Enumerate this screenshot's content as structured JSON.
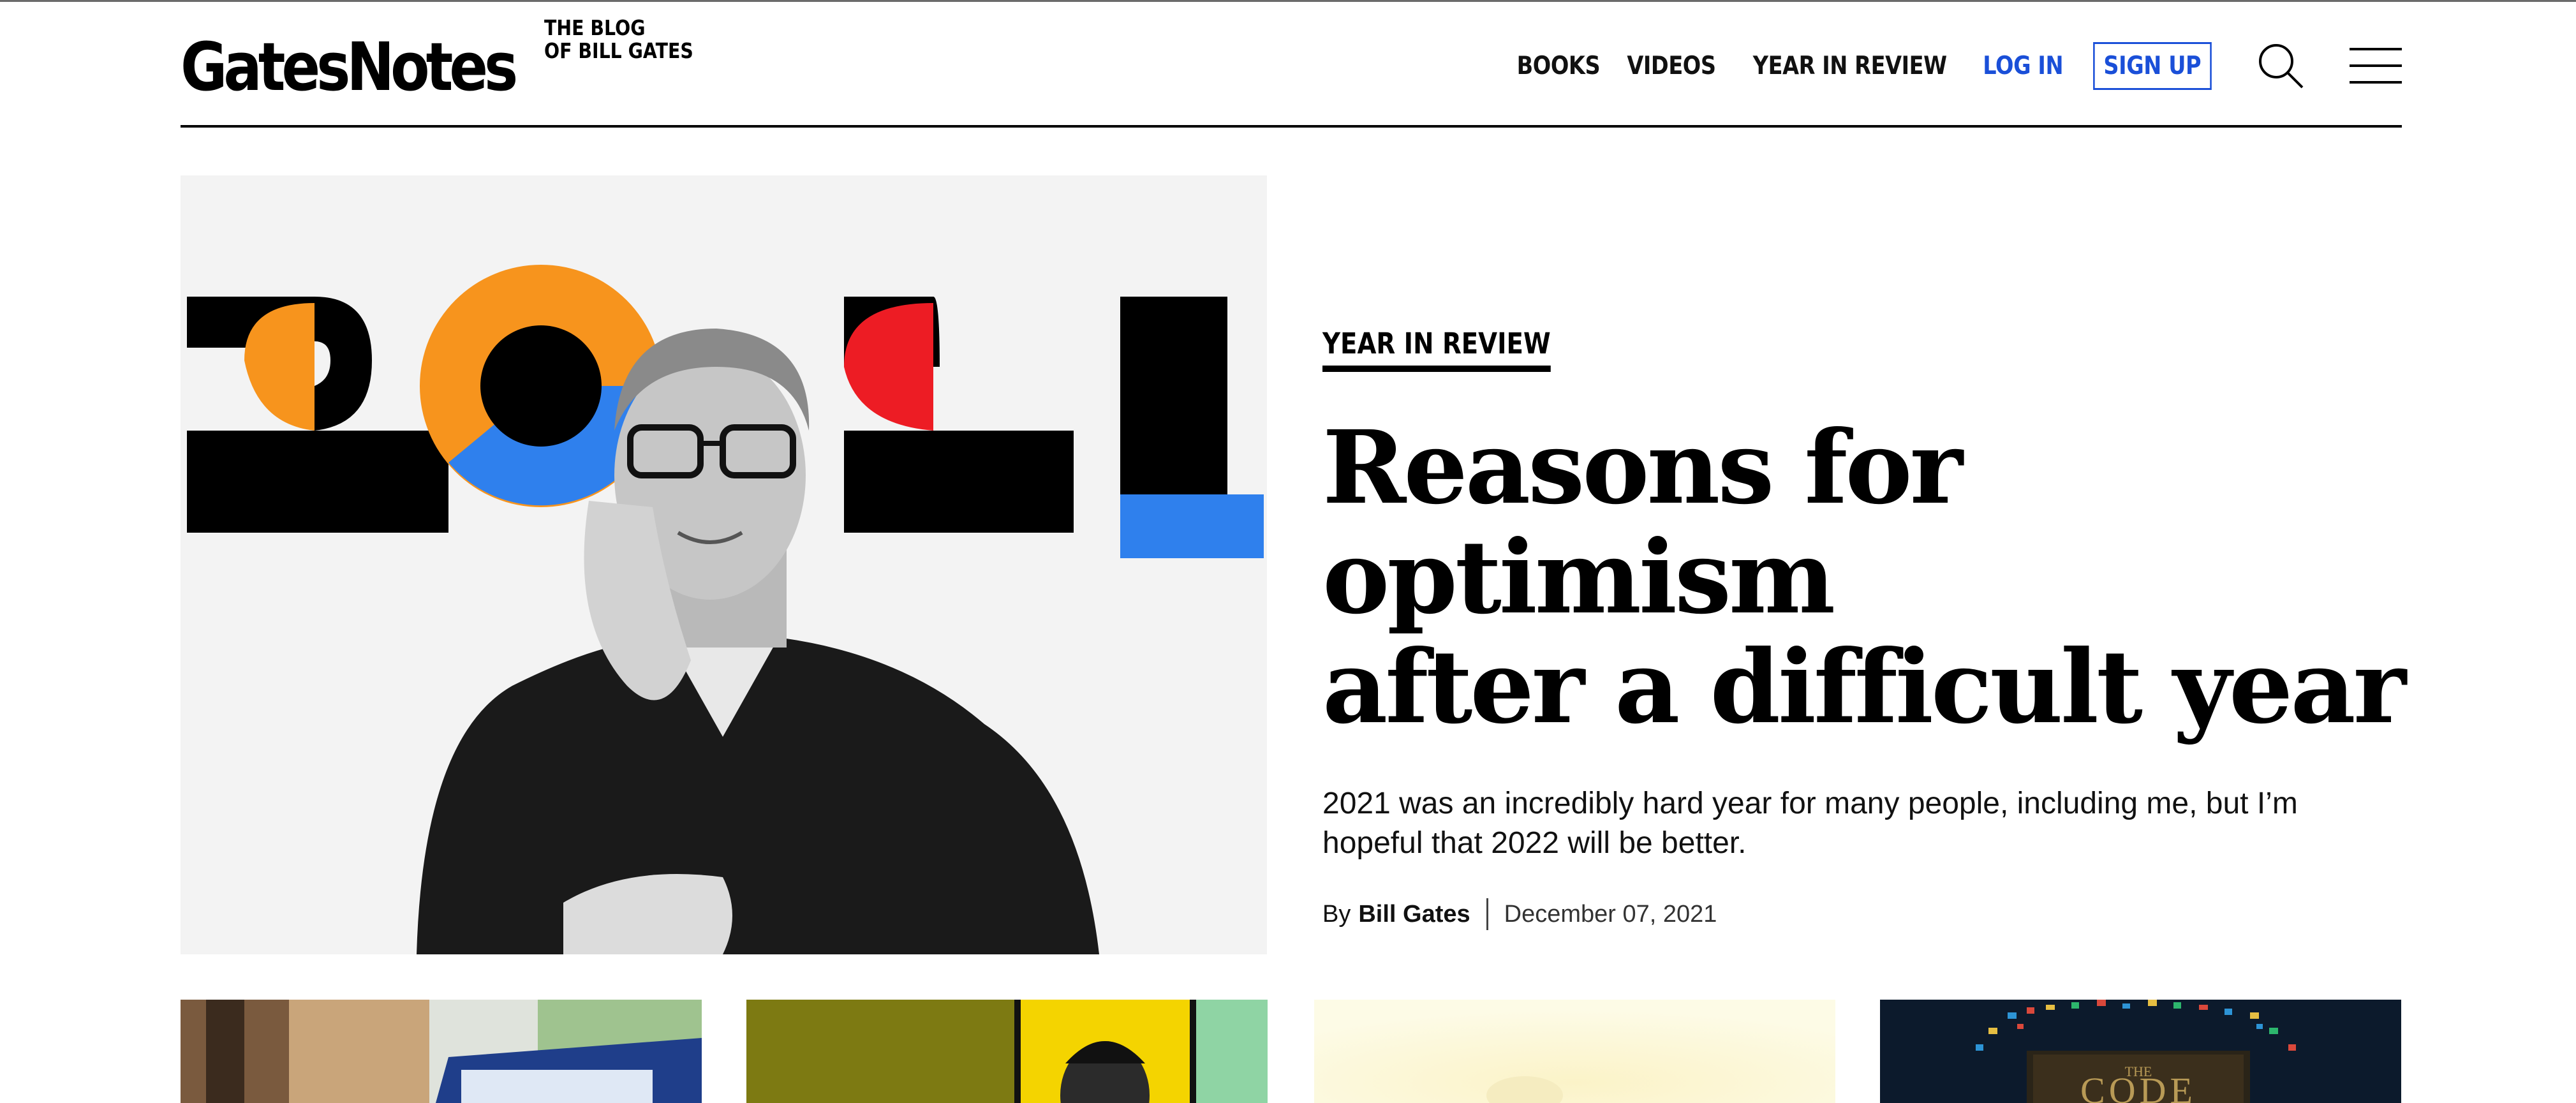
{
  "header": {
    "logo": "GatesNotes",
    "tagline_line1": "THE BLOG",
    "tagline_line2": "OF BILL GATES",
    "nav": [
      {
        "label": "BOOKS"
      },
      {
        "label": "VIDEOS"
      },
      {
        "label": "YEAR IN REVIEW"
      },
      {
        "label": "LOG IN"
      },
      {
        "label": "SIGN UP"
      }
    ],
    "icons": [
      "search-icon",
      "menu-icon"
    ]
  },
  "hero": {
    "image_text": "2021",
    "kicker": "YEAR IN REVIEW",
    "headline_line1": "Reasons for optimism",
    "headline_line2": "after a difficult year",
    "summary_line1": "2021 was an incredibly hard year for many people, including me, but I’m",
    "summary_line2": "hopeful that 2022 will be better.",
    "byline_prefix": "By",
    "author": "Bill Gates",
    "date": "December 07, 2021"
  },
  "cards": [
    {
      "image": "student-laptop"
    },
    {
      "image": "portrait-yellow"
    },
    {
      "image": "pale-yellow"
    },
    {
      "image": "book-cover",
      "cover_text": "THE CODE"
    }
  ],
  "colors": {
    "accent_blue": "#1a4fd8",
    "orange": "#f7941d",
    "red": "#ed1c24",
    "blue": "#2f80ed",
    "black": "#000000"
  }
}
